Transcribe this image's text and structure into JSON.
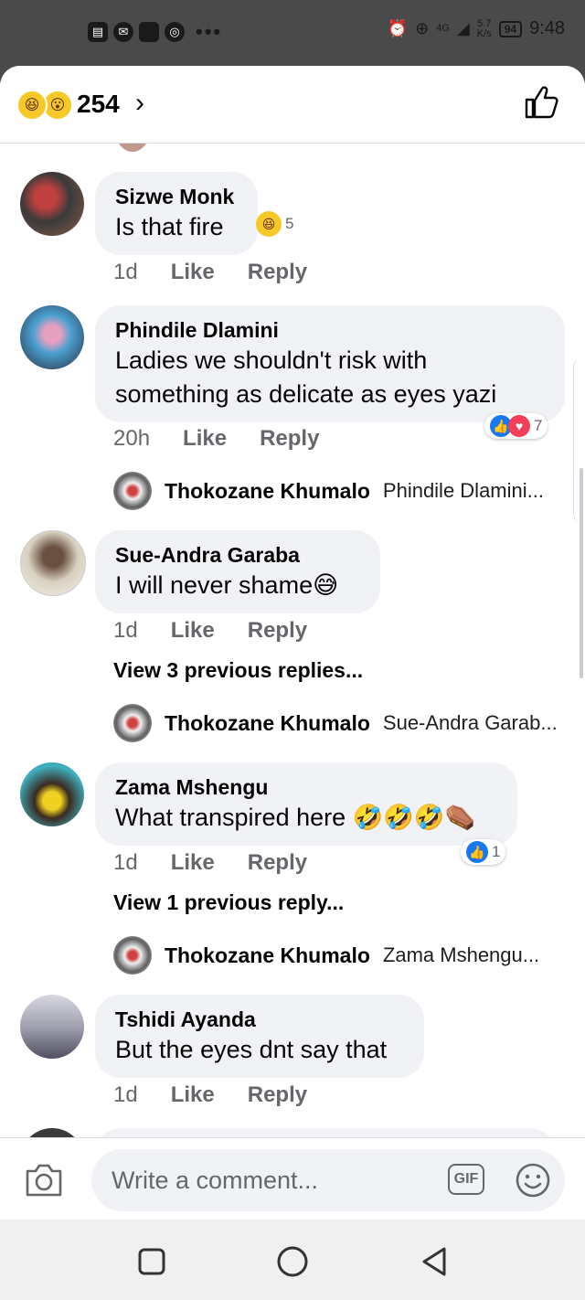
{
  "status_bar": {
    "time": "9:48",
    "network": "4G",
    "speed_top": "5.7",
    "speed_bottom": "K/s",
    "battery": "94",
    "overflow": "•••"
  },
  "header": {
    "reaction_count": "254",
    "reaction_icons": [
      "laughing-emoji",
      "wow-emoji"
    ]
  },
  "comments": [
    {
      "name": "Sizwe Monk",
      "text": "Is that fire",
      "time": "1d",
      "like": "Like",
      "reply": "Reply",
      "reactions": {
        "count": "5",
        "icons": [
          "haha"
        ]
      },
      "avatar_color": "#7a4a3a"
    },
    {
      "name": "Phindile Dlamini",
      "text_lines": [
        "Ladies we shouldn't risk with",
        "something as delicate as eyes yazi"
      ],
      "time": "20h",
      "like": "Like",
      "reply": "Reply",
      "reactions": {
        "count": "7",
        "icons": [
          "like",
          "love"
        ]
      },
      "reply_preview": {
        "name": "Thokozane Khumalo",
        "snippet": "Phindile Dlamini..."
      },
      "avatar_color": "#3a7abf"
    },
    {
      "name": "Sue-Andra Garaba",
      "text": "I will never shame😅",
      "time": "1d",
      "like": "Like",
      "reply": "Reply",
      "view_previous": "View 3 previous replies...",
      "reply_preview": {
        "name": "Thokozane Khumalo",
        "snippet": "Sue-Andra Garab..."
      },
      "avatar_color": "#8a7a6a"
    },
    {
      "name": "Zama Mshengu",
      "text": "What transpired here 🤣🤣🤣⚰️",
      "time": "1d",
      "like": "Like",
      "reply": "Reply",
      "reactions": {
        "count": "1",
        "icons": [
          "like"
        ]
      },
      "view_previous": "View 1 previous reply...",
      "reply_preview": {
        "name": "Thokozane Khumalo",
        "snippet": "Zama Mshengu..."
      },
      "avatar_color": "#3ab0c0"
    },
    {
      "name": "Tshidi Ayanda",
      "text": "But the eyes dnt say that",
      "time": "1d",
      "like": "Like",
      "reply": "Reply",
      "avatar_color": "#6a6a7a"
    }
  ],
  "composer": {
    "placeholder": "Write a comment...",
    "gif_label": "GIF"
  },
  "colors": {
    "bubble": "#f0f2f5",
    "meta": "#65676b",
    "like_blue": "#1877f2",
    "love_red": "#f33e58",
    "haha_yellow": "#f7c928"
  }
}
